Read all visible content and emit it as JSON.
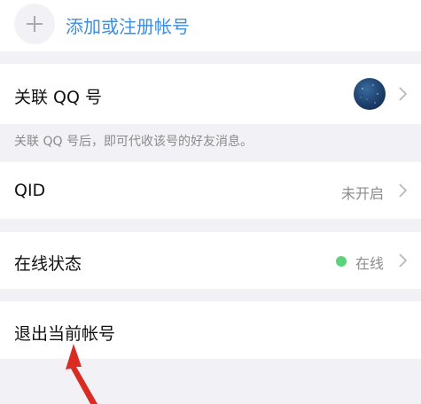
{
  "add_account": {
    "label": "添加或注册帐号"
  },
  "link_qq": {
    "label": "关联 QQ 号",
    "note": "关联 QQ 号后，即可代收该号的好友消息。"
  },
  "qid": {
    "label": "QID",
    "status": "未开启"
  },
  "online_status": {
    "label": "在线状态",
    "status": "在线",
    "status_dot_color": "#5cd37a"
  },
  "logout": {
    "label": "退出当前帐号"
  },
  "colors": {
    "accent_blue": "#3f8de0",
    "page_background": "#f2f2f6",
    "annotation_arrow": "#d92c23"
  },
  "icons": {
    "add": "plus-icon",
    "chevron": "chevron-right-icon",
    "status": "online-dot-icon"
  }
}
